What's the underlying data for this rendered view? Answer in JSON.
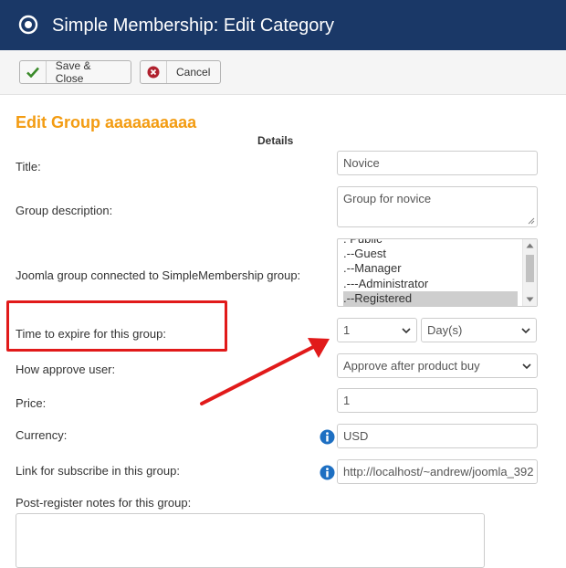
{
  "window": {
    "title": "Simple Membership: Edit Category"
  },
  "toolbar": {
    "save_label": "Save & Close",
    "cancel_label": "Cancel"
  },
  "form": {
    "heading": "Edit Group aaaaaaaaaa",
    "section": "Details",
    "title": {
      "label": "Title:",
      "value": "Novice"
    },
    "description": {
      "label": "Group description:",
      "value": "Group for novice"
    },
    "joomla_group": {
      "label": "Joomla group connected to SimpleMembership group:",
      "options": [
        ". Public",
        ".--Guest",
        ".--Manager",
        ".---Administrator",
        ".--Registered"
      ],
      "selected": ".--Registered"
    },
    "expire": {
      "label": "Time to expire for this group:",
      "amount": "1",
      "unit": "Day(s)"
    },
    "approve": {
      "label": "How approve user:",
      "value": "Approve after product buy"
    },
    "price": {
      "label": "Price:",
      "value": "1"
    },
    "currency": {
      "label": "Currency:",
      "value": "USD"
    },
    "link": {
      "label": "Link for subscribe in this group:",
      "value": "http://localhost/~andrew/joomla_392"
    },
    "notes": {
      "label": "Post-register notes for this group:",
      "value": ""
    }
  },
  "colors": {
    "header": "#1a3867",
    "heading": "#f39c12",
    "annotation": "#e11a1a",
    "info": "#1d6fc2"
  }
}
